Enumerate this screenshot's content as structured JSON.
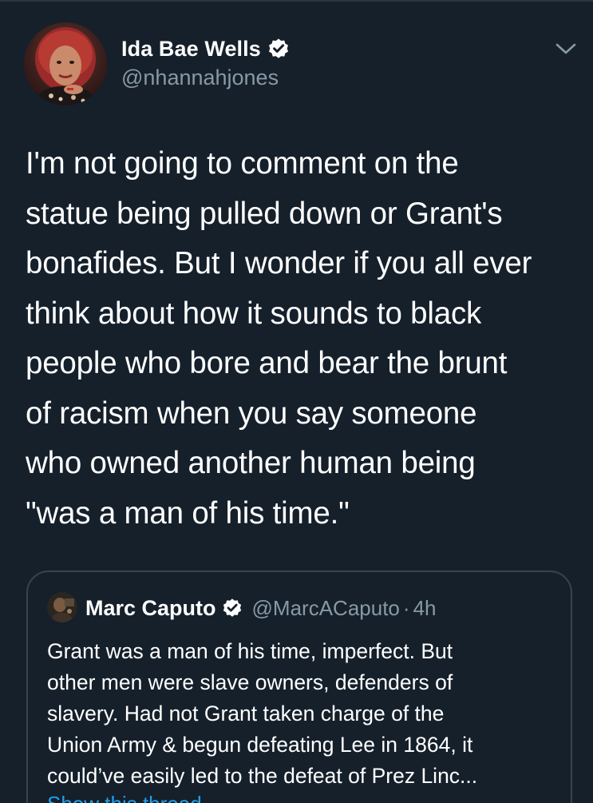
{
  "tweet": {
    "author": {
      "name": "Ida Bae Wells",
      "handle": "@nhannahjones",
      "verified": true
    },
    "text": "I'm not going to comment on the\nstatue being pulled down or Grant's\nbonafides. But I wonder if you all ever\nthink about how it sounds to black\npeople who bore and bear the brunt\nof racism when you say someone\nwho owned another human being\n\"was a man of his time.\"",
    "menu_icon": "chevron-down-icon",
    "quoted": {
      "author": {
        "name": "Marc Caputo",
        "handle": "@MarcACaputo",
        "verified": true
      },
      "separator": "·",
      "time": "4h",
      "text": "Grant was a man of his time, imperfect. But\nother men were slave owners, defenders of\nslavery. Had not Grant taken charge of the\nUnion Army & begun defeating Lee in 1864, it\ncould’ve easily led to the defeat of Prez Linc...",
      "show_thread": "Show this thread"
    }
  },
  "colors": {
    "background": "#15202b",
    "primary_text": "#ffffff",
    "secondary_text": "#8899a6",
    "border": "#38444d",
    "accent": "#1da1f2"
  }
}
